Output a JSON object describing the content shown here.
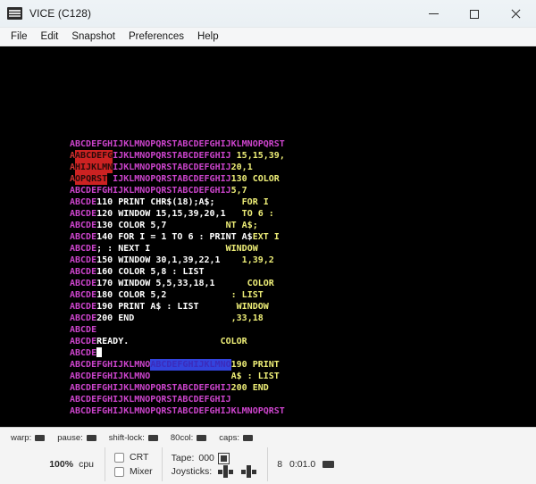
{
  "window": {
    "title": "VICE (C128)",
    "icon": "computer-icon",
    "controls": {
      "minimize": "minimize-icon",
      "maximize": "maximize-icon",
      "close": "close-icon"
    }
  },
  "menubar": {
    "items": [
      {
        "label": "File"
      },
      {
        "label": "Edit"
      },
      {
        "label": "Snapshot"
      },
      {
        "label": "Preferences"
      },
      {
        "label": "Help"
      }
    ]
  },
  "colors": {
    "magenta": "#cc44cc",
    "yellow": "#eeee77",
    "white": "#ffffff",
    "reverse_red_bg": "#cc2222",
    "reverse_blue_bg": "#3344dd",
    "screen_bg": "#000000"
  },
  "screen": {
    "rows": [
      {
        "segs": [
          {
            "t": "ABCDEFGHIJKLMNOPQRSTABCDEFGHIJKLMNOPQRST",
            "s": "fg-magenta"
          }
        ]
      },
      {
        "segs": [
          {
            "t": "A",
            "s": "fg-red-rev"
          },
          {
            "t": "ABCDEFG",
            "s": "rev-red"
          },
          {
            "t": "IJKLMNOPQRSTABCDEFGHIJ",
            "s": "fg-magenta"
          },
          {
            "t": " 15,15,39,",
            "s": "fg-yellow"
          }
        ]
      },
      {
        "segs": [
          {
            "t": "A",
            "s": "fg-red-rev"
          },
          {
            "t": "HIJKLMN",
            "s": "rev-red"
          },
          {
            "t": "IJKLMNOPQRSTABCDEFGHIJ",
            "s": "fg-magenta"
          },
          {
            "t": "20,1",
            "s": "fg-yellow"
          }
        ]
      },
      {
        "segs": [
          {
            "t": "A",
            "s": "fg-red-rev"
          },
          {
            "t": "OPQRST",
            "s": "rev-red"
          },
          {
            "t": " IJKLMNOPQRSTABCDEFGHIJ",
            "s": "fg-magenta"
          },
          {
            "t": "130 COLOR",
            "s": "fg-yellow"
          }
        ]
      },
      {
        "segs": [
          {
            "t": "ABCDEFGHIJKLMNOPQRSTABCDEFGHIJ",
            "s": "fg-magenta"
          },
          {
            "t": "5,7",
            "s": "fg-yellow"
          }
        ]
      },
      {
        "segs": [
          {
            "t": "ABCDE",
            "s": "fg-magenta"
          },
          {
            "t": "110 PRINT CHR$(18);A$;",
            "s": "fg-white"
          },
          {
            "t": "     FOR I",
            "s": "fg-yellow"
          }
        ]
      },
      {
        "segs": [
          {
            "t": "ABCDE",
            "s": "fg-magenta"
          },
          {
            "t": "120 WINDOW 15,15,39,20,1",
            "s": "fg-white"
          },
          {
            "t": "   TO 6 :",
            "s": "fg-yellow"
          }
        ]
      },
      {
        "segs": [
          {
            "t": "ABCDE",
            "s": "fg-magenta"
          },
          {
            "t": "130 COLOR 5,7",
            "s": "fg-white"
          },
          {
            "t": "           NT A$;",
            "s": "fg-yellow"
          }
        ]
      },
      {
        "segs": [
          {
            "t": "ABCDE",
            "s": "fg-magenta"
          },
          {
            "t": "140 FOR I = 1 TO 6 : PRINT A$",
            "s": "fg-white"
          },
          {
            "t": "EXT I",
            "s": "fg-yellow"
          }
        ]
      },
      {
        "segs": [
          {
            "t": "ABCDE",
            "s": "fg-magenta"
          },
          {
            "t": "; : NEXT I",
            "s": "fg-white"
          },
          {
            "t": "              WINDOW",
            "s": "fg-yellow"
          }
        ]
      },
      {
        "segs": [
          {
            "t": "ABCDE",
            "s": "fg-magenta"
          },
          {
            "t": "150 WINDOW 30,1,39,22,1",
            "s": "fg-white"
          },
          {
            "t": "    1,39,2",
            "s": "fg-yellow"
          }
        ]
      },
      {
        "segs": [
          {
            "t": "ABCDE",
            "s": "fg-magenta"
          },
          {
            "t": "160 COLOR 5,8 : LIST",
            "s": "fg-white"
          }
        ]
      },
      {
        "segs": [
          {
            "t": "ABCDE",
            "s": "fg-magenta"
          },
          {
            "t": "170 WINDOW 5,5,33,18,1",
            "s": "fg-white"
          },
          {
            "t": "      COLOR",
            "s": "fg-yellow"
          }
        ]
      },
      {
        "segs": [
          {
            "t": "ABCDE",
            "s": "fg-magenta"
          },
          {
            "t": "180 COLOR 5,2",
            "s": "fg-white"
          },
          {
            "t": "            : LIST",
            "s": "fg-yellow"
          }
        ]
      },
      {
        "segs": [
          {
            "t": "ABCDE",
            "s": "fg-magenta"
          },
          {
            "t": "190 PRINT A$ : LIST",
            "s": "fg-white"
          },
          {
            "t": "       WINDOW",
            "s": "fg-yellow"
          }
        ]
      },
      {
        "segs": [
          {
            "t": "ABCDE",
            "s": "fg-magenta"
          },
          {
            "t": "200 END",
            "s": "fg-white"
          },
          {
            "t": "                  ,33,18",
            "s": "fg-yellow"
          }
        ]
      },
      {
        "segs": [
          {
            "t": "ABCDE",
            "s": "fg-magenta"
          }
        ]
      },
      {
        "segs": [
          {
            "t": "ABCDE",
            "s": "fg-magenta"
          },
          {
            "t": "READY.",
            "s": "fg-white"
          },
          {
            "t": "                 COLOR",
            "s": "fg-yellow"
          }
        ]
      },
      {
        "segs": [
          {
            "t": "ABCDE",
            "s": "fg-magenta"
          },
          {
            "t": "CURSOR",
            "s": "cursor"
          }
        ]
      },
      {
        "segs": [
          {
            "t": "ABCDEFGHIJKLMNO",
            "s": "fg-magenta"
          },
          {
            "t": "ABCDEFGHIJKLMNO",
            "s": "rev-blue"
          },
          {
            "t": "190 PRINT",
            "s": "fg-yellow"
          }
        ]
      },
      {
        "segs": [
          {
            "t": "ABCDEFGHIJKLMNO",
            "s": "fg-magenta"
          },
          {
            "t": "               A$ : LIST",
            "s": "fg-yellow"
          }
        ]
      },
      {
        "segs": [
          {
            "t": "ABCDEFGHIJKLMNOPQRSTABCDEFGHIJ",
            "s": "fg-magenta"
          },
          {
            "t": "200 END",
            "s": "fg-yellow"
          }
        ]
      },
      {
        "segs": [
          {
            "t": "ABCDEFGHIJKLMNOPQRSTABCDEFGHIJ",
            "s": "fg-magenta"
          }
        ]
      },
      {
        "segs": [
          {
            "t": "ABCDEFGHIJKLMNOPQRSTABCDEFGHIJKLMNOPQRST",
            "s": "fg-magenta"
          }
        ]
      }
    ]
  },
  "statusbar": {
    "indicators": [
      {
        "label": "warp:",
        "led": "warp-led"
      },
      {
        "label": "pause:",
        "led": "pause-led"
      },
      {
        "label": "shift-lock:",
        "led": "shift-lock-led"
      },
      {
        "label": "80col:",
        "led": "80col-led"
      },
      {
        "label": "caps:",
        "led": "caps-led"
      }
    ],
    "cpu": {
      "percent": "100%",
      "label": "cpu"
    },
    "toggles": [
      {
        "label": "CRT",
        "checked": false
      },
      {
        "label": "Mixer",
        "checked": false
      }
    ],
    "tape": {
      "label": "Tape:",
      "counter": "000"
    },
    "joysticks": {
      "label": "Joysticks:"
    },
    "drive": {
      "number": "8",
      "time": "0:01.0"
    }
  }
}
